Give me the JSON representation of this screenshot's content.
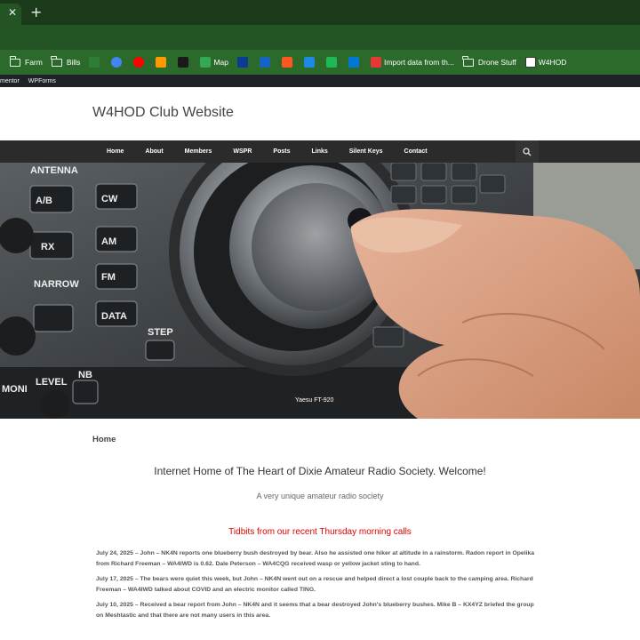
{
  "browser": {
    "tab_close": "✕",
    "new_tab": "+",
    "bookmarks": [
      {
        "type": "folder",
        "label": "Farm"
      },
      {
        "type": "folder",
        "label": "Bills"
      },
      {
        "type": "icon",
        "label": "",
        "color": "#2e7d32"
      },
      {
        "type": "icon",
        "label": "",
        "color": "#4285f4"
      },
      {
        "type": "icon",
        "label": "",
        "color": "#ff0000"
      },
      {
        "type": "icon",
        "label": "",
        "color": "#ff9900"
      },
      {
        "type": "icon",
        "label": "",
        "color": "#1a1a1a"
      },
      {
        "type": "icon",
        "label": "Map",
        "color": "#34a853"
      },
      {
        "type": "icon",
        "label": "",
        "color": "#0a3d91"
      },
      {
        "type": "icon",
        "label": "",
        "color": "#1565c0"
      },
      {
        "type": "icon",
        "label": "",
        "color": "#ff5722"
      },
      {
        "type": "icon",
        "label": "",
        "color": "#1e88e5"
      },
      {
        "type": "icon",
        "label": "",
        "color": "#1db954"
      },
      {
        "type": "icon",
        "label": "",
        "color": "#0078d4"
      },
      {
        "type": "icon",
        "label": "Import data from th...",
        "color": "#e53935"
      },
      {
        "type": "folder",
        "label": "Drone Stuff"
      },
      {
        "type": "icon",
        "label": "W4HOD",
        "color": "#ffffff"
      }
    ],
    "wp_items": [
      "mentor",
      "WPForms"
    ]
  },
  "site": {
    "title": "W4HOD Club Website",
    "nav": [
      "Home",
      "About",
      "Members",
      "WSPR",
      "Posts",
      "Links",
      "Silent Keys",
      "Contact"
    ],
    "hero_caption": "Yaesu FT-920",
    "hero_buttons": [
      "ANTENNA",
      "A/B",
      "RX",
      "NARROW",
      "CW",
      "AM",
      "FM",
      "DATA",
      "STEP",
      "MONI",
      "LEVEL",
      "NB"
    ]
  },
  "content": {
    "breadcrumb": "Home",
    "welcome": "Internet Home of The Heart of Dixie Amateur Radio Society. Welcome!",
    "subtitle": "A very unique amateur radio society",
    "tidbits_heading": "Tidbits from our recent Thursday morning calls",
    "entries": [
      "July 24, 2025 – John – NK4N  reports one blueberry bush destroyed by bear.  Also he assisted one hiker at altitude in a rainstorm. Radon report in Opelika from Richard Freeman – WA4IWD is 0.62.  Dale Peterson – WA4CQG received wasp or yellow jacket sting to hand.",
      "July 17, 2025 – The bears were quiet this week, but John – NK4N went out on a rescue and helped direct a lost couple back to the camping area. Richard Freeman – WA4IWD talked about COVID and an electric monitor called TING.",
      "July 10, 2025 – Received a bear report from John – NK4N and it seems that a bear destroyed John's blueberry bushes. Mike B – KX4YZ briefed the group on Meshtastic and that there are not many users in this area."
    ]
  }
}
